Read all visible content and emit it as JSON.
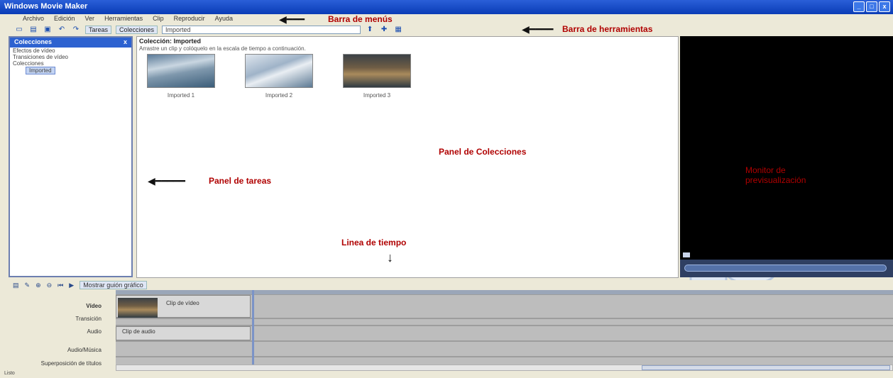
{
  "window": {
    "title": "Windows Movie Maker"
  },
  "menu": [
    "Archivo",
    "Edición",
    "Ver",
    "Herramientas",
    "Clip",
    "Reproducir",
    "Ayuda"
  ],
  "toolbar": {
    "tasks": "Tareas",
    "collections": "Colecciones",
    "collection_value": "Imported"
  },
  "task_panel": {
    "header": "Colecciones",
    "tree": [
      "Efectos de vídeo",
      "Transiciones de vídeo",
      "Colecciones",
      "Imported"
    ]
  },
  "collections_panel": {
    "path": "Colección: Imported",
    "hint": "Arrastre un clip y colóquelo en la escala de tiempo a continuación.",
    "clips": [
      {
        "name": "Imported 1"
      },
      {
        "name": "Imported 2"
      },
      {
        "name": "Imported 3"
      }
    ]
  },
  "annotations": {
    "menu_bar": "Barra de menús",
    "tool_bar": "Barra de herramientas",
    "collections_panel": "Panel de Colecciones",
    "tasks_panel": "Panel de tareas",
    "timeline": "Linea de tiempo",
    "preview_line1": "Monitor de",
    "preview_line2": "previsualización"
  },
  "timeline": {
    "toggle": "Mostrar guión gráfico",
    "tracks": [
      "Vídeo",
      "Transición",
      "Audio",
      "Audio/Música",
      "Superposición de títulos"
    ],
    "video_clip": "Clip de vídeo",
    "audio_clip": "Clip de audio"
  },
  "status": {
    "text": "Listo"
  },
  "colors": {
    "title_bar": "#0a3cb6",
    "annotation": "#b00000",
    "preview_bg": "#000000"
  }
}
